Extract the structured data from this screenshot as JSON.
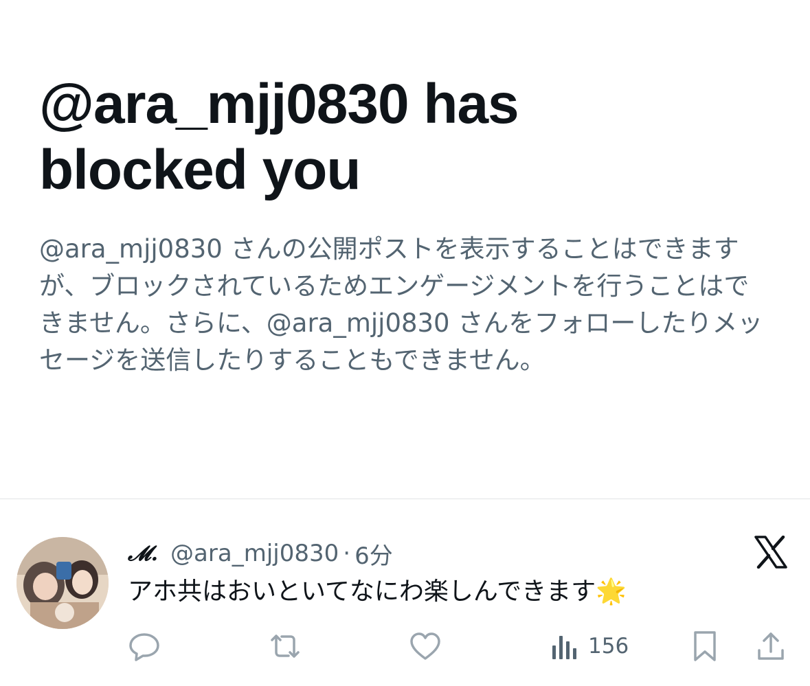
{
  "block_notice": {
    "headline": "@ara_mjj0830 has blocked you",
    "description": "@ara_mjj0830 さんの公開ポストを表示することはできますが、ブロックされているためエンゲージメントを行うことはできません。さらに、@ara_mjj0830 さんをフォローしたりメッセージを送信したりすることもできません。"
  },
  "tweet": {
    "display_name": "𝓜.",
    "handle": "@ara_mjj0830",
    "separator": "·",
    "time": "6分",
    "text": "アホ共はおいといてなにわ楽しんできます",
    "emoji": "🌟",
    "views": "156",
    "icons": {
      "reply": "reply-icon",
      "repost": "repost-icon",
      "like": "like-icon",
      "views": "views-icon",
      "bookmark": "bookmark-icon",
      "share": "share-icon",
      "brand": "x-logo-icon"
    }
  },
  "colors": {
    "text_primary": "#0f1419",
    "text_secondary": "#536471",
    "icon_gray": "#9aa5ae",
    "divider": "#e1e4e6"
  }
}
